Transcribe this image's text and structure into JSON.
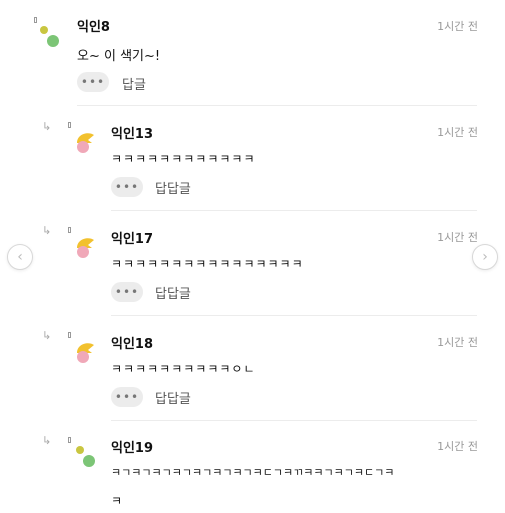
{
  "comments": [
    {
      "nick": "익인8",
      "time": "1시간 전",
      "text": "오~ 이 색기~!",
      "reply_label": "답글",
      "more": "•••"
    },
    {
      "nick": "익인13",
      "time": "1시간 전",
      "text": "ㅋㅋㅋㅋㅋㅋㅋㅋㅋㅋㅋㅋ",
      "reply_label": "답답글",
      "more": "•••"
    },
    {
      "nick": "익인17",
      "time": "1시간 전",
      "text": "ㅋㅋㅋㅋㅋㅋㅋㅋㅋㅋㅋㅋㅋㅋㅋㅋ",
      "reply_label": "답답글",
      "more": "•••"
    },
    {
      "nick": "익인18",
      "time": "1시간 전",
      "text": "ㅋㅋㅋㅋㅋㅋㅋㅋㅋㅋㅇㄴ",
      "reply_label": "답답글",
      "more": "•••"
    },
    {
      "nick": "익인19",
      "time": "1시간 전",
      "text": "ㅋㄱㅋㄱㅋㄱㅋㄱㅋㄱㅋㄱㅋㄱㅋㄷㄱㅋㄲㅋㅋㄱㅋㄱㅋㄷㄱㅋ",
      "text2": "ㅋ"
    }
  ],
  "icons": {
    "reply_arrow": "↳",
    "prev": "‹",
    "next": "›"
  },
  "colors": {
    "avatar_green": "#7cc576",
    "avatar_yellow": "#f2c12e",
    "avatar_pink": "#f0a8b8",
    "avatar_olive": "#c9c640"
  }
}
